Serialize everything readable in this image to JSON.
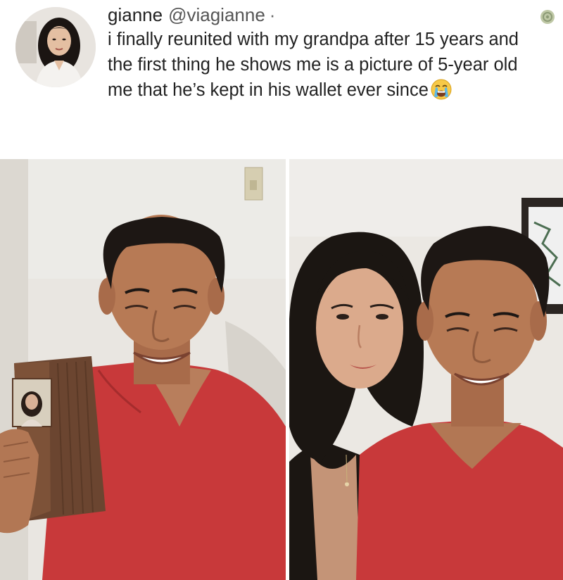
{
  "post": {
    "display_name": "gianne",
    "handle": "@viagianne",
    "separator": "·",
    "text": "i finally reunited with my grandpa after 15 years and the first thing he shows me is a picture of 5-year old me that he’s kept in his wallet ever since",
    "emoji": "crying-face-emoji"
  },
  "media": {
    "photo_left": "photo-grandpa-with-wallet",
    "photo_right": "photo-granddaughter-and-grandpa-selfie"
  },
  "colors": {
    "shirt_red": "#c8393a",
    "skin": "#b77a55",
    "wall": "#e9e6e1",
    "hair": "#1d1714"
  }
}
